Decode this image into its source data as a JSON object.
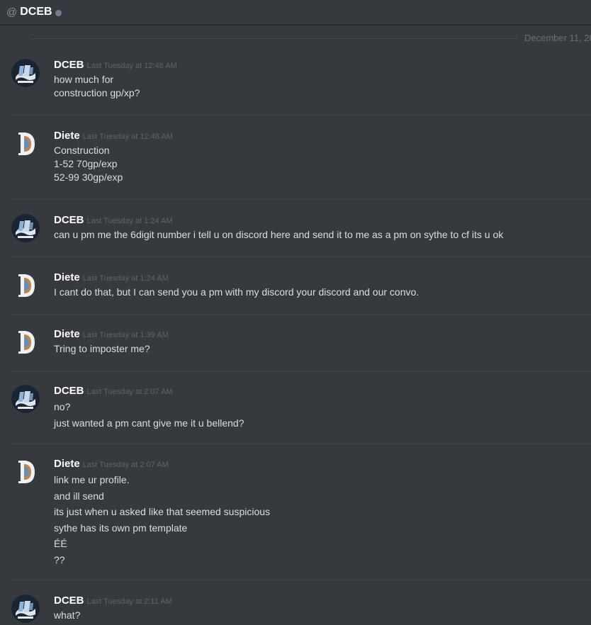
{
  "header": {
    "at_symbol": "@",
    "dm_name": "DCEB",
    "status": "offline"
  },
  "date_divider": "December 11, 20",
  "colors": {
    "background": "#36393e",
    "username": "#ffffff",
    "message_text": "#dcddde",
    "timestamp": "#5f6369",
    "status_offline": "#747f8d"
  },
  "messages": [
    {
      "author": "DCEB",
      "avatar": "dceb-logo-avatar",
      "timestamp": "Last Tuesday at 12:48 AM",
      "lines": [
        "how much for",
        "construction gp/xp?"
      ]
    },
    {
      "author": "Diete",
      "avatar": "letter-d-avatar",
      "timestamp": "Last Tuesday at 12:48 AM",
      "lines": [
        "Construction",
        "1-52 70gp/exp",
        "52-99 30gp/exp"
      ]
    },
    {
      "author": "DCEB",
      "avatar": "dceb-logo-avatar",
      "timestamp": "Last Tuesday at 1:24 AM",
      "lines": [
        "can u pm me the 6digit number i tell u on discord here and send it to me as a pm on sythe to cf its u ok"
      ]
    },
    {
      "author": "Diete",
      "avatar": "letter-d-avatar",
      "timestamp": "Last Tuesday at 1:24 AM",
      "lines": [
        "I cant do that, but I can send you a pm with my discord your discord and our convo."
      ]
    },
    {
      "author": "Diete",
      "avatar": "letter-d-avatar",
      "timestamp": "Last Tuesday at 1:39 AM",
      "lines": [
        "Tring to imposter me?"
      ]
    },
    {
      "author": "DCEB",
      "avatar": "dceb-logo-avatar",
      "timestamp": "Last Tuesday at 2:07 AM",
      "lines": [
        "no?",
        "just wanted a pm cant give me it u bellend?"
      ]
    },
    {
      "author": "Diete",
      "avatar": "letter-d-avatar",
      "timestamp": "Last Tuesday at 2:07 AM",
      "lines": [
        "link me ur profile.",
        "and ill send",
        "its just when u asked like that seemed suspicious",
        "sythe has its own pm template",
        "ÉÉ",
        "??"
      ]
    },
    {
      "author": "DCEB",
      "avatar": "dceb-logo-avatar",
      "timestamp": "Last Tuesday at 2:11 AM",
      "lines": [
        "what?"
      ]
    }
  ]
}
